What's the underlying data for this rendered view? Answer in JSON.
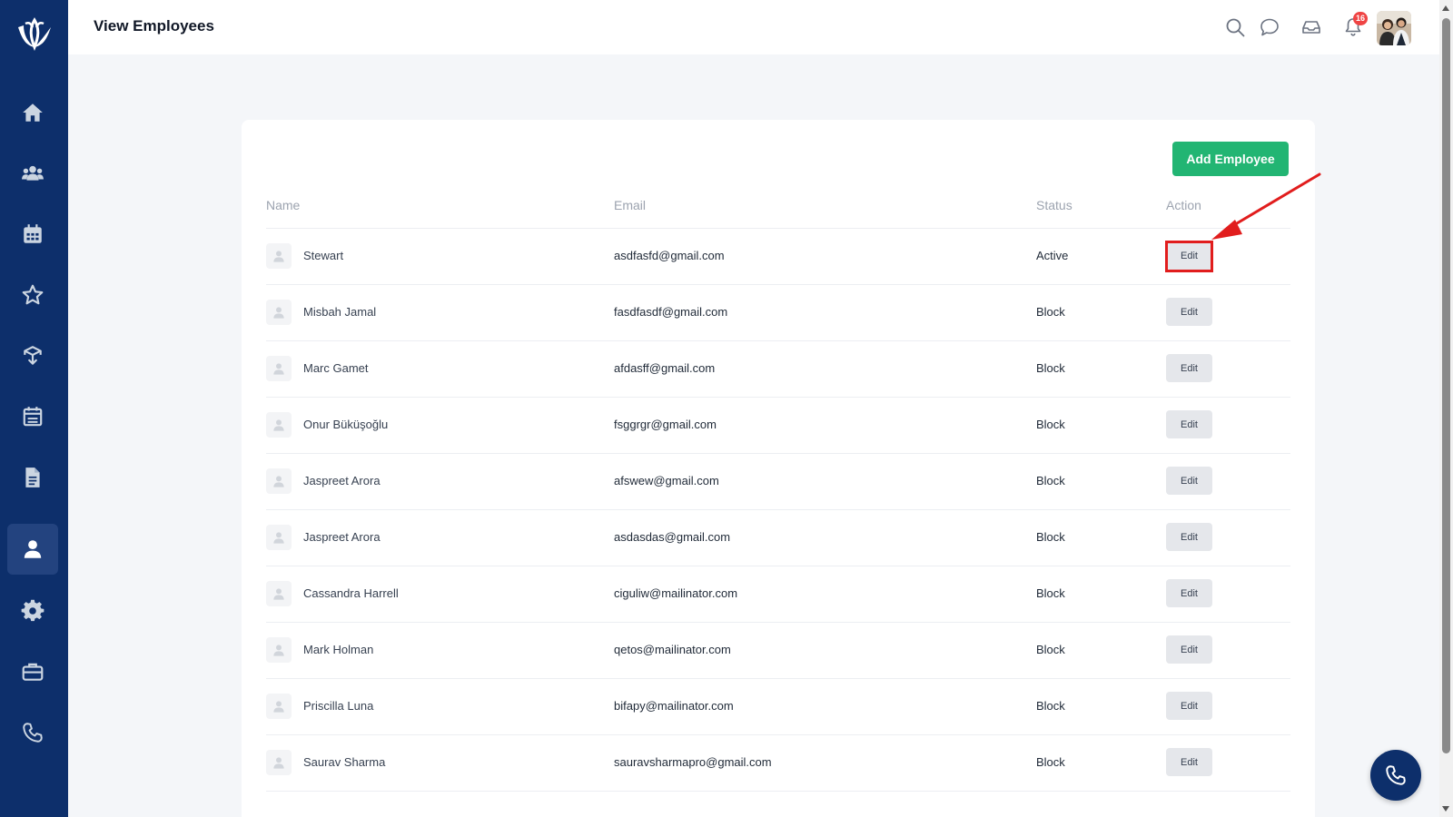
{
  "header": {
    "title": "View Employees",
    "notification_count": "16"
  },
  "sidebar": {
    "items": [
      {
        "icon": "home-icon"
      },
      {
        "icon": "users-icon"
      },
      {
        "icon": "calendar-icon"
      },
      {
        "icon": "star-icon"
      },
      {
        "icon": "box-icon"
      },
      {
        "icon": "schedule-icon"
      },
      {
        "icon": "document-icon"
      },
      {
        "icon": "user-icon",
        "active": true
      },
      {
        "icon": "gear-icon"
      },
      {
        "icon": "briefcase-icon"
      },
      {
        "icon": "phone-icon"
      }
    ]
  },
  "table": {
    "add_button": "Add Employee",
    "columns": [
      "Name",
      "Email",
      "Status",
      "Action"
    ],
    "rows": [
      {
        "name": "Stewart",
        "email": "asdfasfd@gmail.com",
        "status": "Active",
        "action": "Edit"
      },
      {
        "name": "Misbah Jamal",
        "email": "fasdfasdf@gmail.com",
        "status": "Block",
        "action": "Edit"
      },
      {
        "name": "Marc Gamet",
        "email": "afdasff@gmail.com",
        "status": "Block",
        "action": "Edit"
      },
      {
        "name": "Onur Büküşoğlu",
        "email": "fsggrgr@gmail.com",
        "status": "Block",
        "action": "Edit"
      },
      {
        "name": "Jaspreet Arora",
        "email": "afswew@gmail.com",
        "status": "Block",
        "action": "Edit"
      },
      {
        "name": "Jaspreet Arora",
        "email": "asdasdas@gmail.com",
        "status": "Block",
        "action": "Edit"
      },
      {
        "name": "Cassandra Harrell",
        "email": "ciguliw@mailinator.com",
        "status": "Block",
        "action": "Edit"
      },
      {
        "name": "Mark Holman",
        "email": "qetos@mailinator.com",
        "status": "Block",
        "action": "Edit"
      },
      {
        "name": "Priscilla Luna",
        "email": "bifapy@mailinator.com",
        "status": "Block",
        "action": "Edit"
      },
      {
        "name": "Saurav Sharma",
        "email": "sauravsharmapro@gmail.com",
        "status": "Block",
        "action": "Edit"
      }
    ]
  },
  "colors": {
    "sidebar": "#0d2f6b",
    "accent_green": "#22b573",
    "badge_red": "#ef4444",
    "annotation_red": "#e11d1d"
  }
}
